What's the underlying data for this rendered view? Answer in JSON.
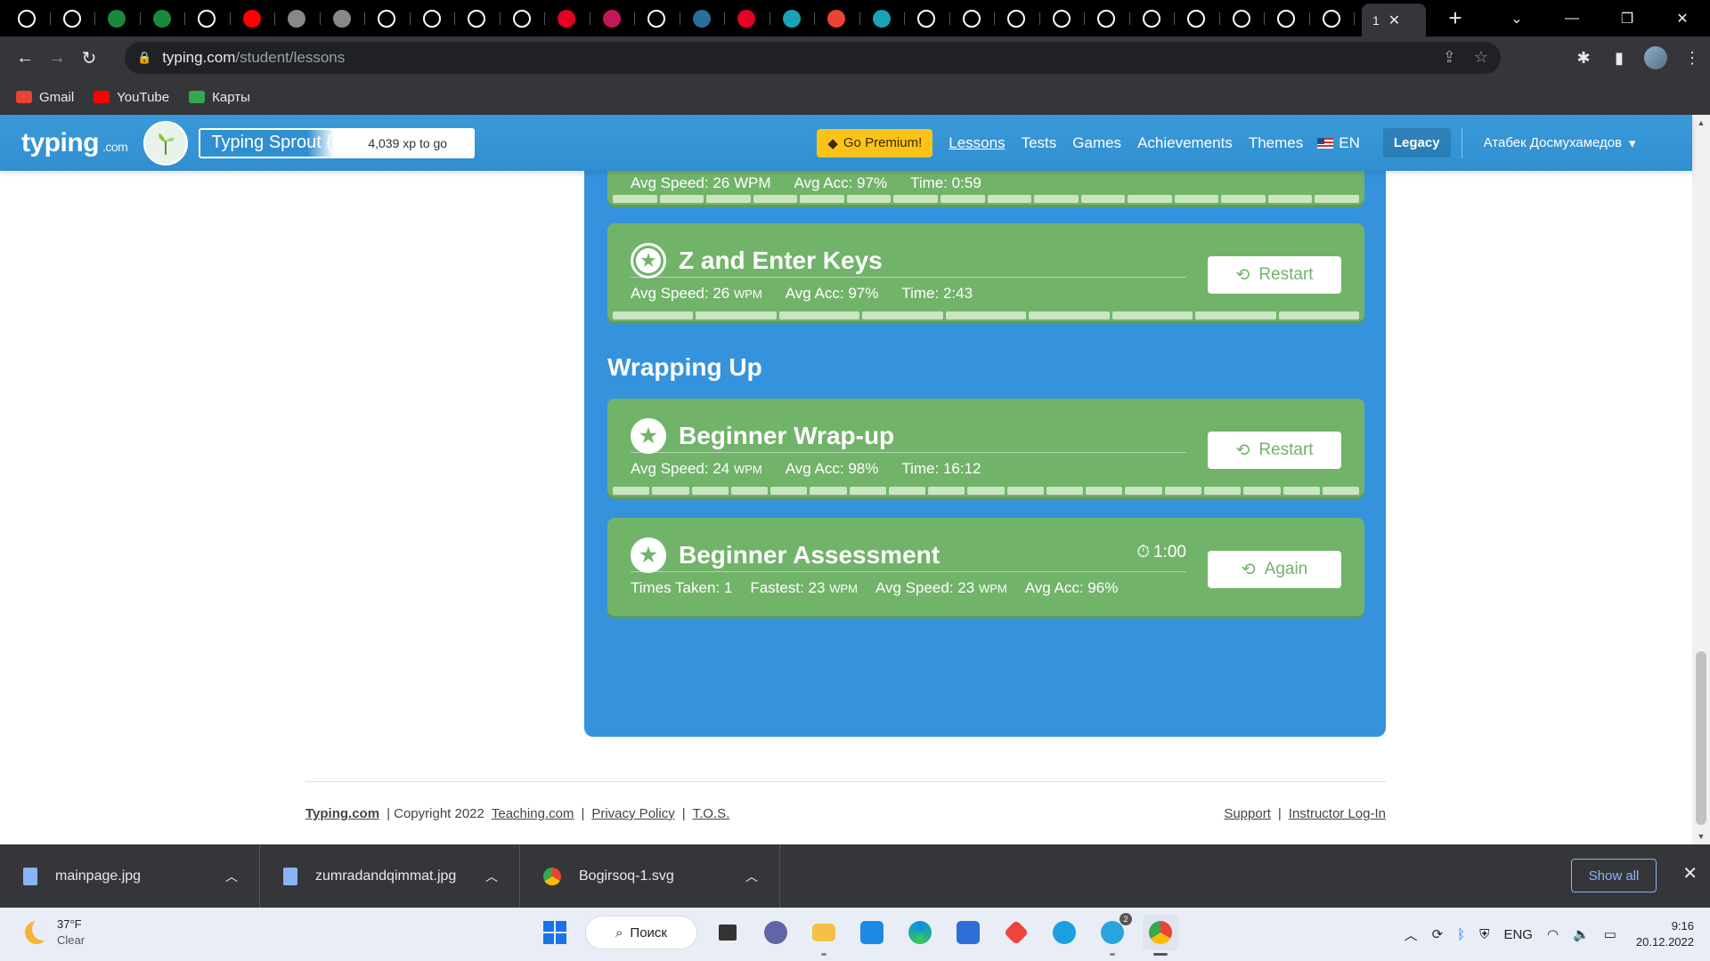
{
  "browser": {
    "tabs": [
      {
        "icon": "globe-icon",
        "color": "#ffffff"
      },
      {
        "icon": "google-icon",
        "color": "#ffffff"
      },
      {
        "icon": "w-icon",
        "color": "#1a8a3a"
      },
      {
        "icon": "w-icon",
        "color": "#1a8a3a"
      },
      {
        "icon": "google-icon",
        "color": "#ffffff"
      },
      {
        "icon": "youtube-icon",
        "color": "#ff0000"
      },
      {
        "icon": "image-icon",
        "color": "#888888"
      },
      {
        "icon": "image-icon",
        "color": "#888888"
      },
      {
        "icon": "globe-icon",
        "color": "#ffffff"
      },
      {
        "icon": "globe-icon",
        "color": "#ffffff"
      },
      {
        "icon": "globe-icon",
        "color": "#ffffff"
      },
      {
        "icon": "google-icon",
        "color": "#ffffff"
      },
      {
        "icon": "pinterest-icon",
        "color": "#e60023"
      },
      {
        "icon": "box-icon",
        "color": "#c2185b"
      },
      {
        "icon": "google-icon",
        "color": "#ffffff"
      },
      {
        "icon": "star-icon",
        "color": "#2a6f97"
      },
      {
        "icon": "pinterest-icon",
        "color": "#e60023"
      },
      {
        "icon": "diamond-icon",
        "color": "#1aa3b5"
      },
      {
        "icon": "gmail-icon",
        "color": "#ea4335"
      },
      {
        "icon": "diamond-icon",
        "color": "#1aa3b5"
      },
      {
        "icon": "globe-icon",
        "color": "#ffffff"
      },
      {
        "icon": "globe-icon",
        "color": "#ffffff"
      },
      {
        "icon": "globe-icon",
        "color": "#ffffff"
      },
      {
        "icon": "globe-icon",
        "color": "#ffffff"
      },
      {
        "icon": "globe-icon",
        "color": "#ffffff"
      },
      {
        "icon": "globe-icon",
        "color": "#ffffff"
      },
      {
        "icon": "globe-icon",
        "color": "#ffffff"
      },
      {
        "icon": "globe-icon",
        "color": "#ffffff"
      },
      {
        "icon": "globe-icon",
        "color": "#ffffff"
      },
      {
        "icon": "globe-icon",
        "color": "#ffffff"
      }
    ],
    "active_tab_label": "1",
    "url_host": "typing.com",
    "url_path": "/student/lessons",
    "bookmarks": [
      {
        "label": "Gmail",
        "icon": "gmail-icon",
        "color": "#ea4335"
      },
      {
        "label": "YouTube",
        "icon": "youtube-icon",
        "color": "#ff0000"
      },
      {
        "label": "Карты",
        "icon": "maps-icon",
        "color": "#34a853"
      }
    ]
  },
  "site": {
    "logo": "typing",
    "logo_suffix": ".com",
    "rank_name": "Typing Sprout (...",
    "xp_to_go": "4,039 xp to go",
    "premium_label": "Go Premium!",
    "nav": [
      "Lessons",
      "Tests",
      "Games",
      "Achievements",
      "Themes"
    ],
    "lang": "EN",
    "legacy": "Legacy",
    "user": "Атабек Досмухамедов",
    "accent": "#3593dd",
    "card_color": "#72b36a"
  },
  "lessons": {
    "top_partial": {
      "stats": [
        "Avg Speed: 26 WPM",
        "Avg Acc: 97%",
        "Time: 0:59"
      ]
    },
    "z_enter": {
      "title": "Z and Enter Keys",
      "speed_label": "Avg Speed:",
      "speed": "26",
      "speed_unit": "WPM",
      "acc": "Avg Acc: 97%",
      "time": "Time: 2:43",
      "button": "Restart"
    },
    "section_title": "Wrapping Up",
    "wrapup": {
      "title": "Beginner Wrap-up",
      "speed_label": "Avg Speed:",
      "speed": "24",
      "speed_unit": "WPM",
      "acc": "Avg Acc: 98%",
      "time": "Time: 16:12",
      "button": "Restart"
    },
    "assessment": {
      "title": "Beginner Assessment",
      "timer": "1:00",
      "times_taken": "Times Taken: 1",
      "fastest_label": "Fastest:",
      "fastest": "23",
      "fastest_unit": "WPM",
      "speed_label": "Avg Speed:",
      "speed": "23",
      "speed_unit": "WPM",
      "acc": "Avg Acc: 96%",
      "button": "Again"
    }
  },
  "footer": {
    "brand": "Typing.com",
    "copyright": "| Copyright 2022",
    "links_left": [
      "Teaching.com",
      "Privacy Policy",
      "T.O.S."
    ],
    "links_right": [
      "Support",
      "Instructor Log-In"
    ]
  },
  "downloads": {
    "items": [
      "mainpage.jpg",
      "zumradandqimmat.jpg",
      "Bogirsoq-1.svg"
    ],
    "show_all": "Show all"
  },
  "taskbar": {
    "temp": "37°F",
    "condition": "Clear",
    "search": "Поиск",
    "lang": "ENG",
    "time": "9:16",
    "date": "20.12.2022",
    "telegram_badge": "2"
  }
}
